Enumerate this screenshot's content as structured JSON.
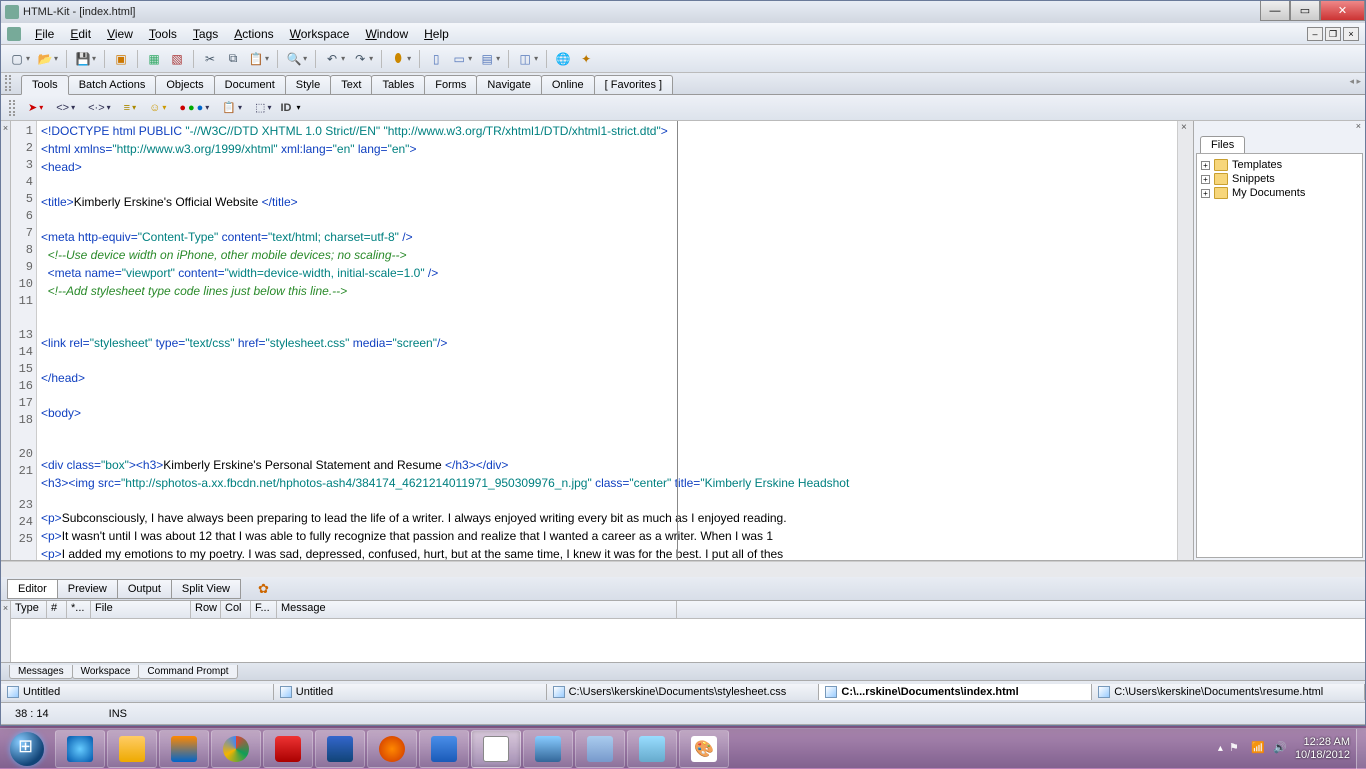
{
  "window": {
    "title": "HTML-Kit - [index.html]"
  },
  "menu": [
    "File",
    "Edit",
    "View",
    "Tools",
    "Tags",
    "Actions",
    "Workspace",
    "Window",
    "Help"
  ],
  "tabbar": [
    "Tools",
    "Batch Actions",
    "Objects",
    "Document",
    "Style",
    "Text",
    "Tables",
    "Forms",
    "Navigate",
    "Online",
    "[ Favorites ]"
  ],
  "toolbar2_id": "ID",
  "sidepanel": {
    "tab": "Files",
    "items": [
      "Templates",
      "Snippets",
      "My Documents"
    ]
  },
  "lines": [
    "1",
    "2",
    "3",
    "4",
    "5",
    "6",
    "7",
    "8",
    "9",
    "10",
    "11",
    "",
    "13",
    "14",
    "15",
    "16",
    "17",
    "18",
    "",
    "20",
    "21",
    "",
    "23",
    "24",
    "25"
  ],
  "code_lines": [
    {
      "t": "doc",
      "raw": "<!DOCTYPE html PUBLIC \"-//W3C//DTD XHTML 1.0 Strict//EN\" \"http://www.w3.org/TR/xhtml1/DTD/xhtml1-strict.dtd\">"
    },
    {
      "t": "tag",
      "raw": "<html xmlns=\"http://www.w3.org/1999/xhtml\" xml:lang=\"en\" lang=\"en\">"
    },
    {
      "t": "tag",
      "raw": "<head>"
    },
    {
      "t": "",
      "raw": ""
    },
    {
      "t": "mix",
      "open": "<title>",
      "text": "Kimberly Erskine's Official Website ",
      "close": "</title>"
    },
    {
      "t": "",
      "raw": ""
    },
    {
      "t": "tag",
      "raw": "<meta http-equiv=\"Content-Type\" content=\"text/html; charset=utf-8\" />"
    },
    {
      "t": "cmt",
      "raw": "  <!--Use device width on iPhone, other mobile devices; no scaling-->"
    },
    {
      "t": "tag",
      "raw": "  <meta name=\"viewport\" content=\"width=device-width, initial-scale=1.0\" />"
    },
    {
      "t": "cmt",
      "raw": "  <!--Add stylesheet type code lines just below this line.-->"
    },
    {
      "t": "",
      "raw": ""
    },
    {
      "t": "",
      "raw": ""
    },
    {
      "t": "tag",
      "raw": "<link rel=\"stylesheet\" type=\"text/css\" href=\"stylesheet.css\" media=\"screen\"/>"
    },
    {
      "t": "",
      "raw": ""
    },
    {
      "t": "tag",
      "raw": "</head>"
    },
    {
      "t": "",
      "raw": ""
    },
    {
      "t": "tag",
      "raw": "<body>"
    },
    {
      "t": "",
      "raw": ""
    },
    {
      "t": "",
      "raw": ""
    },
    {
      "t": "mix",
      "open": "<div class=\"box\"><h3>",
      "text": "Kimberly Erskine's Personal Statement and Resume ",
      "close": "</h3></div>"
    },
    {
      "t": "imgline",
      "open1": "<h3><img src=",
      "str": "\"http://sphotos-a.xx.fbcdn.net/hphotos-ash4/384174_4621214011971_950309976_n.jpg\"",
      "mid": " class=",
      "str2": "\"center\"",
      "mid2": " title=",
      "str3": "\"Kimberly Erskine Headshot"
    },
    {
      "t": "",
      "raw": ""
    },
    {
      "t": "mix",
      "open": "<p>",
      "text": "Subconsciously, I have always been preparing to lead the life of a writer. I always enjoyed writing every bit as much as I enjoyed reading.",
      "close": ""
    },
    {
      "t": "mix",
      "open": "<p>",
      "text": "It wasn't until I was about 12 that I was able to fully recognize that passion and realize that I wanted a career as a writer. When I was 1",
      "close": ""
    },
    {
      "t": "mix",
      "open": "<p>",
      "text": "I added my emotions to my poetry. I was sad, depressed, confused, hurt, but at the same time, I knew it was for the best. I put all of thes",
      "close": ""
    }
  ],
  "viewtabs": [
    "Editor",
    "Preview",
    "Output",
    "Split View"
  ],
  "output_headers": [
    "Type",
    "#",
    "*...",
    "File",
    "Row",
    "Col",
    "F...",
    "Message"
  ],
  "lowertabs": [
    "Messages",
    "Workspace",
    "Command Prompt"
  ],
  "filetabs": [
    {
      "label": "Untitled",
      "active": false
    },
    {
      "label": "Untitled",
      "active": false
    },
    {
      "label": "C:\\Users\\kerskine\\Documents\\stylesheet.css",
      "active": false
    },
    {
      "label": "C:\\...rskine\\Documents\\index.html",
      "active": true
    },
    {
      "label": "C:\\Users\\kerskine\\Documents\\resume.html",
      "active": false
    }
  ],
  "status": {
    "pos": "38 : 14",
    "mode": "INS"
  },
  "tray": {
    "time": "12:28 AM",
    "date": "10/18/2012"
  }
}
